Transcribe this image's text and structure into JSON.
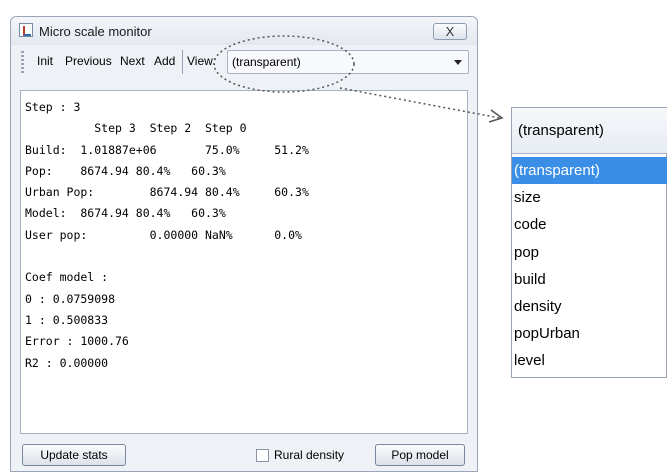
{
  "window": {
    "title": "Micro scale monitor",
    "close_label": "X"
  },
  "toolbar": {
    "init": "Init",
    "previous": "Previous",
    "next": "Next",
    "add": "Add",
    "view_label": "View:",
    "view_value": "(transparent)"
  },
  "output": {
    "lines": [
      "Step : 3",
      "          Step 3  Step 2  Step 0",
      "Build:  1.01887e+06       75.0%     51.2%",
      "Pop:    8674.94 80.4%   60.3%",
      "Urban Pop:        8674.94 80.4%     60.3%",
      "Model:  8674.94 80.4%   60.3%",
      "User pop:         0.00000 NaN%      0.0%",
      "",
      "Coef model :",
      "0 : 0.0759098",
      "1 : 0.500833",
      "Error : 1000.76",
      "R2 : 0.00000"
    ]
  },
  "bottom": {
    "update_stats": "Update stats",
    "rural_density": "Rural density",
    "rural_density_checked": false,
    "pop_model": "Pop model"
  },
  "dropdown_zoom": {
    "selected": "(transparent)",
    "options": [
      "(transparent)",
      "size",
      "code",
      "pop",
      "build",
      "density",
      "popUrban",
      "level"
    ]
  },
  "colors": {
    "highlight": "#3a8ee6",
    "window_bg": "#eef1f6"
  }
}
